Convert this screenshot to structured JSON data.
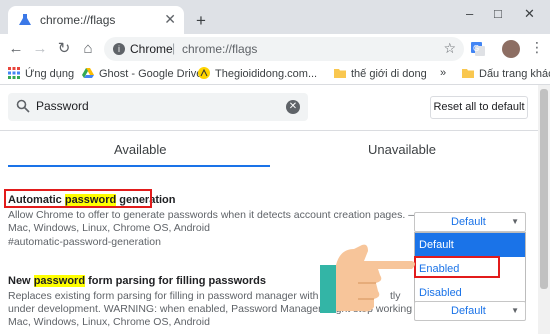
{
  "browser": {
    "tab_title": "chrome://flags",
    "new_tab_symbol": "+",
    "window_controls": [
      "–",
      "□",
      "✕"
    ],
    "omnibox": {
      "site": "Chrome",
      "url": "chrome://flags"
    },
    "bookmarks": [
      {
        "label": "Ứng dụng",
        "icon": "apps-grid-icon"
      },
      {
        "label": "Ghost - Google Drive",
        "icon": "google-drive-icon"
      },
      {
        "label": "Thegioididong.com...",
        "icon": "tgdd-icon"
      },
      {
        "label": "thế giới di dong",
        "icon": "folder-icon"
      },
      {
        "label": "»",
        "icon": ""
      },
      {
        "label": "Dấu trang khác",
        "icon": "folder-icon"
      }
    ]
  },
  "flags_page": {
    "search": {
      "value": "Password"
    },
    "reset_label": "Reset all to default",
    "tabs": [
      "Available",
      "Unavailable"
    ],
    "flags": [
      {
        "title_pre": "Automatic ",
        "title_hl": "password",
        "title_post": " generation",
        "desc_line1": "Allow Chrome to offer to generate passwords when it detects account creation pages. –",
        "desc_line2": "Mac, Windows, Linux, Chrome OS, Android",
        "anchor": "#automatic-password-generation",
        "selected": "Default",
        "options": [
          "Default",
          "Enabled",
          "Disabled"
        ]
      },
      {
        "title_pre": "New ",
        "title_hl": "password",
        "title_post": " form parsing for filling passwords",
        "desc_line1": "Replaces existing form parsing for filling in password manager with a new",
        "desc_line1_tail": "tly",
        "desc_line2": "under development. WARNING: when enabled, Password Manager might stop working",
        "desc_line3": "Mac, Windows, Linux, Chrome OS, Android",
        "selected": "Default"
      }
    ]
  },
  "colors": {
    "accent": "#1a73e8",
    "highlight": "#ffff00",
    "annotation": "#e21b1b"
  }
}
